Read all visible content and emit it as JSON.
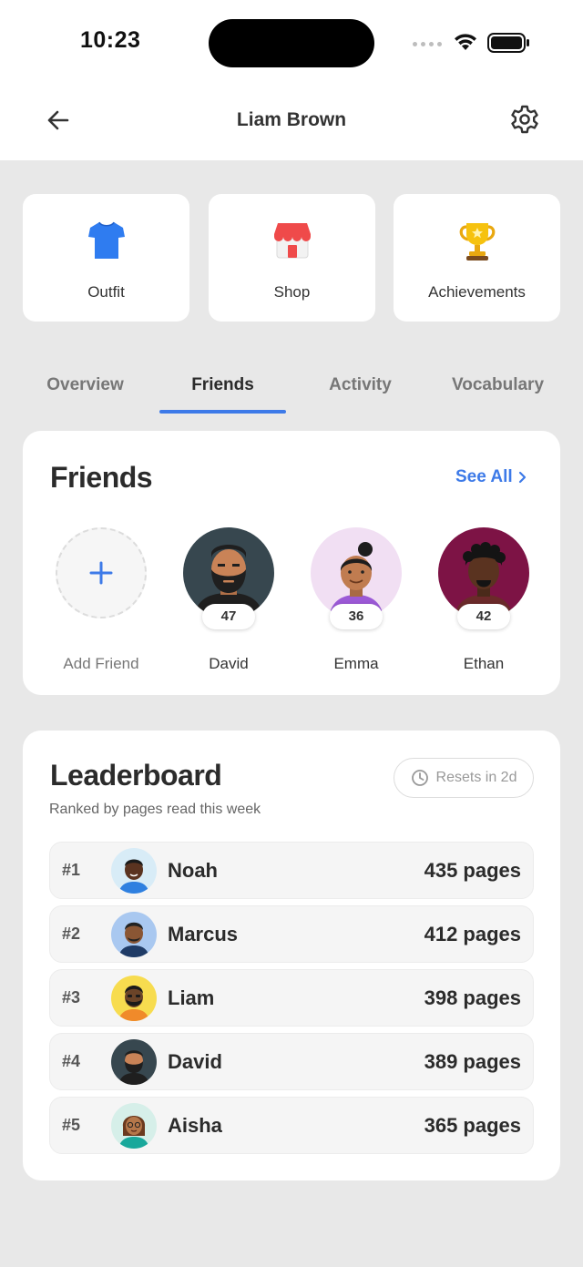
{
  "status_bar": {
    "time": "10:23"
  },
  "header": {
    "title": "Liam Brown"
  },
  "quick_actions": [
    {
      "label": "Outfit",
      "icon": "tshirt-icon"
    },
    {
      "label": "Shop",
      "icon": "shop-icon"
    },
    {
      "label": "Achievements",
      "icon": "trophy-icon"
    }
  ],
  "tabs": [
    {
      "label": "Overview"
    },
    {
      "label": "Friends",
      "active": true
    },
    {
      "label": "Activity"
    },
    {
      "label": "Vocabulary"
    }
  ],
  "friends": {
    "title": "Friends",
    "see_all": "See All",
    "add_label": "Add Friend",
    "list": [
      {
        "name": "David",
        "score": "47"
      },
      {
        "name": "Emma",
        "score": "36"
      },
      {
        "name": "Ethan",
        "score": "42"
      }
    ]
  },
  "leaderboard": {
    "title": "Leaderboard",
    "resets": "Resets in 2d",
    "subtitle": "Ranked by pages read this week",
    "rows": [
      {
        "rank": "#1",
        "name": "Noah",
        "pages": "435 pages"
      },
      {
        "rank": "#2",
        "name": "Marcus",
        "pages": "412 pages"
      },
      {
        "rank": "#3",
        "name": "Liam",
        "pages": "398 pages"
      },
      {
        "rank": "#4",
        "name": "David",
        "pages": "389 pages"
      },
      {
        "rank": "#5",
        "name": "Aisha",
        "pages": "365 pages"
      }
    ]
  },
  "colors": {
    "accent": "#3d7ae8",
    "background": "#e8e8e8",
    "card": "#ffffff"
  }
}
